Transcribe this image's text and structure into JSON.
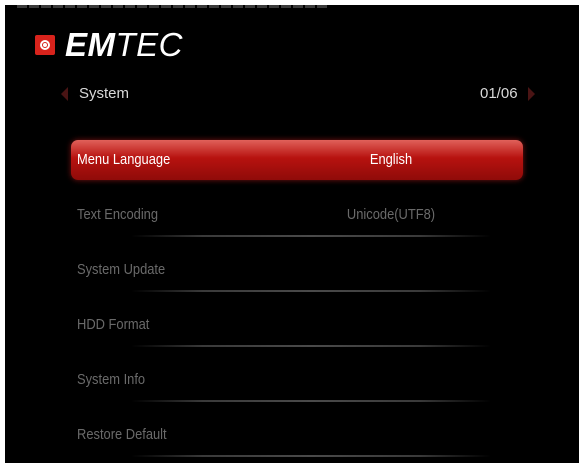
{
  "brand": {
    "logo_bold": "EM",
    "logo_rest": "TEC"
  },
  "header": {
    "section_title": "System",
    "page_counter": "01/06"
  },
  "menu": {
    "items": [
      {
        "label": "Menu Language",
        "value": "English",
        "selected": true
      },
      {
        "label": "Text Encoding",
        "value": "Unicode(UTF8)",
        "selected": false
      },
      {
        "label": "System Update",
        "value": "",
        "selected": false
      },
      {
        "label": "HDD Format",
        "value": "",
        "selected": false
      },
      {
        "label": "System Info",
        "value": "",
        "selected": false
      },
      {
        "label": "Restore Default",
        "value": "",
        "selected": false
      }
    ]
  },
  "colors": {
    "accent": "#c41914",
    "background": "#000000",
    "text_dim": "#6a6a6a"
  },
  "icons": {
    "logo": "emtec-logo-icon",
    "prev": "chevron-left-icon",
    "next": "chevron-right-icon"
  }
}
